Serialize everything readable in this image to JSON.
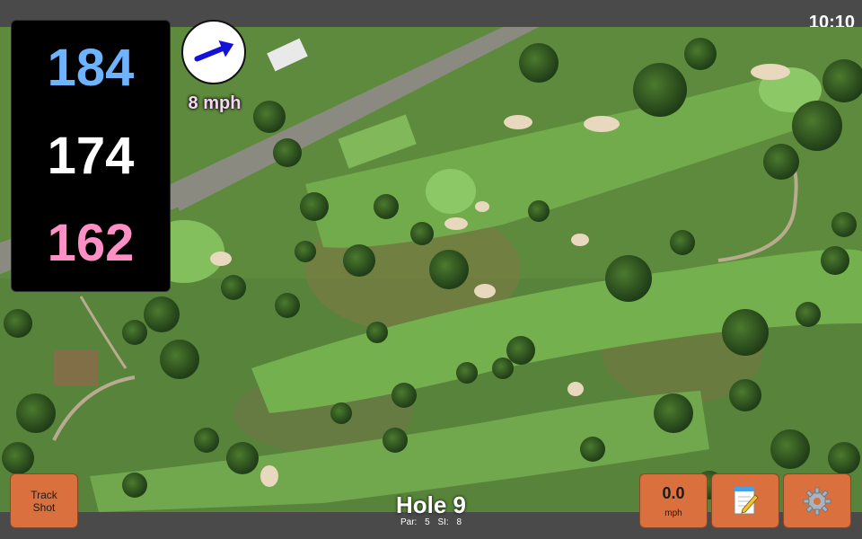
{
  "status": {
    "time": "10:10"
  },
  "distances": {
    "back": "184",
    "middle": "174",
    "front": "162"
  },
  "wind": {
    "speed_label": "8 mph",
    "direction_icon": "arrow-icon"
  },
  "hole": {
    "title": "Hole 9",
    "par_label": "Par: 5",
    "si_label": "SI: 8"
  },
  "buttons": {
    "track_shot_label": "Track Shot",
    "wind_value": "0.0",
    "wind_unit": "mph",
    "notes_icon": "notepad-icon",
    "settings_icon": "gear-icon"
  },
  "colors": {
    "back_distance": "#6eb3ff",
    "middle_distance": "#ffffff",
    "front_distance": "#ff8fc4",
    "button": "#d9703d"
  }
}
